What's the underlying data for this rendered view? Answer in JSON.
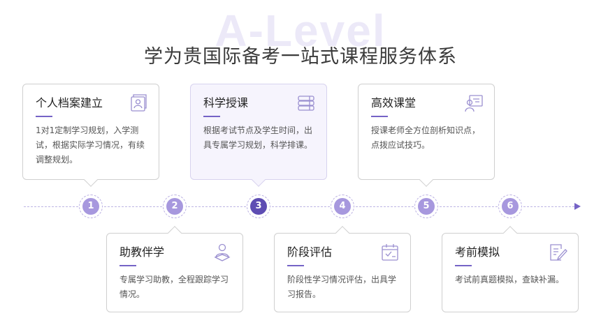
{
  "watermark": "A-Level",
  "title": "学为贵国际备考一站式课程服务体系",
  "steps": [
    {
      "number": "1",
      "title": "个人档案建立",
      "desc": "1对1定制学习规划，入学测试，根据实际学习情况，有续调整规划。",
      "icon": "profile-folder-icon"
    },
    {
      "number": "2",
      "title": "助教伴学",
      "desc": "专属学习助教，全程跟踪学习情况。",
      "icon": "tutor-user-icon"
    },
    {
      "number": "3",
      "title": "科学授课",
      "desc": "根据考试节点及学生时间，出具专属学习规划，科学排课。",
      "icon": "books-stack-icon"
    },
    {
      "number": "4",
      "title": "阶段评估",
      "desc": "阶段性学习情况评估，出具学习报告。",
      "icon": "calendar-check-icon"
    },
    {
      "number": "5",
      "title": "高效课堂",
      "desc": "授课老师全方位剖析知识点，点拨应试技巧。",
      "icon": "teacher-board-icon"
    },
    {
      "number": "6",
      "title": "考前模拟",
      "desc": "考试前真题模拟，查缺补漏。",
      "icon": "exam-edit-icon"
    }
  ],
  "colors": {
    "accent": "#7563c6",
    "active_dot": "#5e4db3",
    "dot": "#a798de"
  }
}
